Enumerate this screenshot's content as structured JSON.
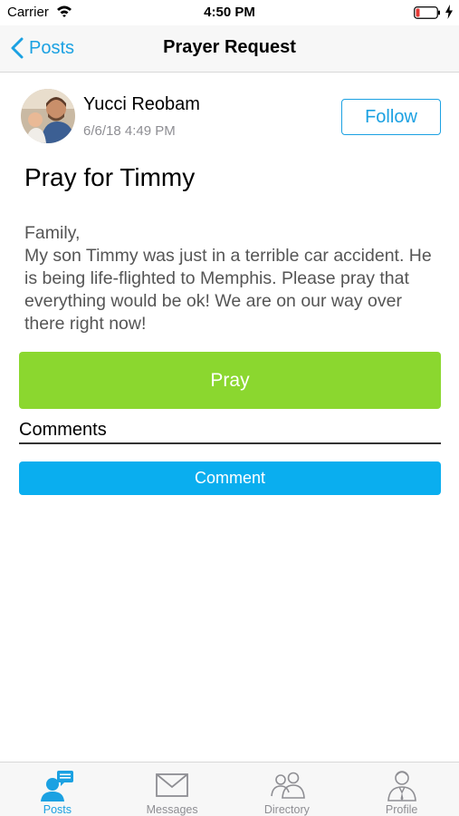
{
  "status_bar": {
    "carrier": "Carrier",
    "time": "4:50 PM"
  },
  "nav": {
    "back_label": "Posts",
    "title": "Prayer Request"
  },
  "post": {
    "author_name": "Yucci Reobam",
    "timestamp": "6/6/18 4:49 PM",
    "follow_label": "Follow",
    "title": "Pray for Timmy",
    "body": "Family,\n  My son Timmy was just in a terrible car accident.  He is being life-flighted to Memphis.  Please pray that everything would be ok!  We are on our way over there right now!",
    "pray_label": "Pray",
    "comments_heading": "Comments",
    "comment_label": "Comment"
  },
  "tabs": [
    {
      "label": "Posts",
      "icon": "posts-icon",
      "active": true
    },
    {
      "label": "Messages",
      "icon": "messages-icon",
      "active": false
    },
    {
      "label": "Directory",
      "icon": "directory-icon",
      "active": false
    },
    {
      "label": "Profile",
      "icon": "profile-icon",
      "active": false
    }
  ],
  "colors": {
    "accent": "#1ba1e2",
    "pray_button": "#8bd72f",
    "comment_button": "#0aaeef",
    "battery_low": "#e53935"
  }
}
